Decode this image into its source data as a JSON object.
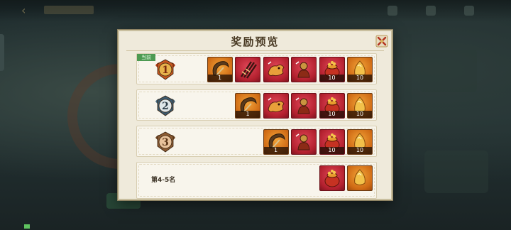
{
  "modal": {
    "title": "奖励预览"
  },
  "colors": {
    "panel": "#efeadb",
    "gold_item": "#cf6a14",
    "red_item": "#b2202e",
    "current_tag": "#4d9a52"
  },
  "ranks": [
    {
      "medal": "rank-1-medal-icon",
      "medal_text": "1",
      "tag": "当前",
      "rewards": [
        {
          "icon": "crescent-weapon-icon",
          "qty": "1"
        },
        {
          "icon": "sword-bundle-icon",
          "qty": ""
        },
        {
          "icon": "red-beast-icon",
          "qty": ""
        },
        {
          "icon": "armored-warrior-icon",
          "qty": ""
        },
        {
          "icon": "treasure-pot-icon",
          "qty": "10"
        },
        {
          "icon": "gold-ingot-icon",
          "qty": "10"
        }
      ]
    },
    {
      "medal": "rank-2-medal-icon",
      "medal_text": "2",
      "rewards": [
        {
          "icon": "crescent-weapon-icon",
          "qty": "1"
        },
        {
          "icon": "red-beast-icon",
          "qty": ""
        },
        {
          "icon": "armored-warrior-icon",
          "qty": ""
        },
        {
          "icon": "treasure-pot-icon",
          "qty": "10"
        },
        {
          "icon": "gold-ingot-icon",
          "qty": "10"
        }
      ]
    },
    {
      "medal": "rank-3-medal-icon",
      "medal_text": "3",
      "rewards": [
        {
          "icon": "crescent-weapon-icon",
          "qty": "1"
        },
        {
          "icon": "armored-warrior-icon",
          "qty": ""
        },
        {
          "icon": "treasure-pot-icon",
          "qty": "10"
        },
        {
          "icon": "gold-ingot-icon",
          "qty": "10"
        }
      ]
    },
    {
      "label": "第4-5名",
      "rewards": [
        {
          "icon": "treasure-pot-icon",
          "qty": ""
        },
        {
          "icon": "gold-ingot-icon",
          "qty": ""
        }
      ]
    }
  ]
}
